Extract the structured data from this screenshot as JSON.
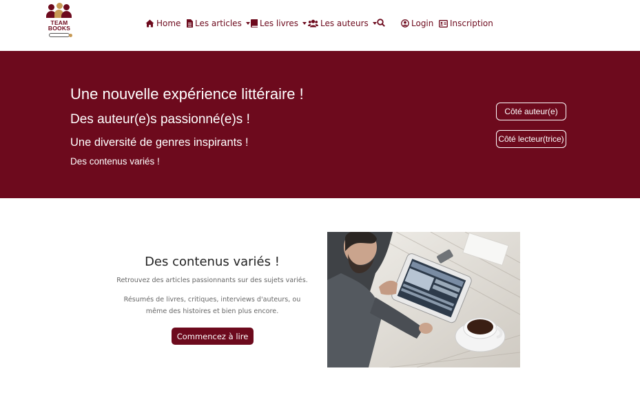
{
  "brand": {
    "logo_text_line1": "TEAM",
    "logo_text_line2": "BOOKS"
  },
  "nav": {
    "home": "Home",
    "articles": "Les articles",
    "livres": "Les livres",
    "auteurs": "Les auteurs",
    "login": "Login",
    "inscription": "Inscription"
  },
  "hero": {
    "line1": "Une nouvelle expérience littéraire !",
    "line2": "Des auteur(e)s passionné(e)s !",
    "line3": "Une diversité de genres inspirants !",
    "line4": "Des contenus variés !",
    "btn_auteur": "Côté auteur(e)",
    "btn_lecteur": "Côté lecteur(trice)"
  },
  "section": {
    "title": "Des contenus variés !",
    "paragraph1": "Retrouvez des articles passionnants sur des sujets variés.",
    "paragraph2": "Résumés de livres, critiques, interviews d'auteurs, ou même des histoires et bien plus encore.",
    "cta": "Commencez à lire"
  },
  "colors": {
    "brand": "#6d0a1d",
    "accent": "#c79a55",
    "white": "#ffffff"
  },
  "icons": [
    "home-icon",
    "file-icon",
    "book-icon",
    "users-icon",
    "search-icon",
    "user-circle-icon",
    "id-card-icon"
  ]
}
